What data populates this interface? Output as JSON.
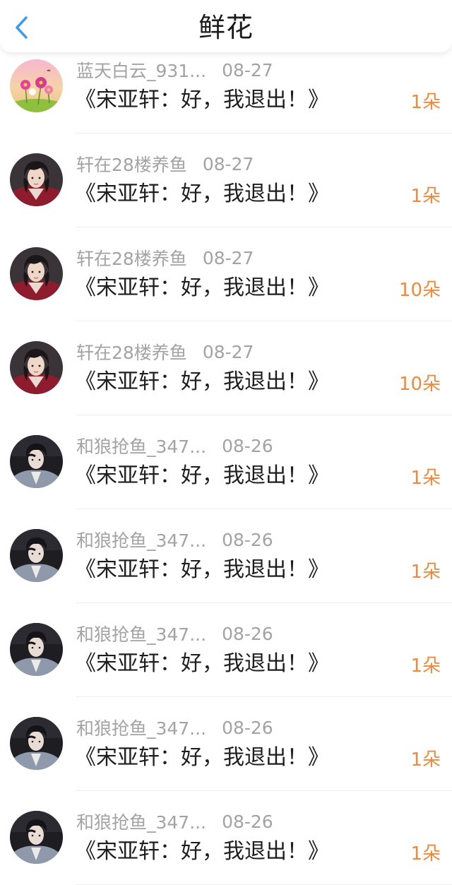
{
  "header": {
    "title": "鲜花",
    "back_icon": "chevron-left-icon",
    "accent_color": "#3a9bf0"
  },
  "count_color": "#ef8a3c",
  "entries": [
    {
      "user": "蓝天白云_931...",
      "date": "08-27",
      "book": "《宋亚轩：好，我退出！》",
      "count": "1朵",
      "avatar": "flowers"
    },
    {
      "user": "轩在28楼养鱼",
      "date": "08-27",
      "book": "《宋亚轩：好，我退出！》",
      "count": "1朵",
      "avatar": "red-robe"
    },
    {
      "user": "轩在28楼养鱼",
      "date": "08-27",
      "book": "《宋亚轩：好，我退出！》",
      "count": "10朵",
      "avatar": "red-robe"
    },
    {
      "user": "轩在28楼养鱼",
      "date": "08-27",
      "book": "《宋亚轩：好，我退出！》",
      "count": "10朵",
      "avatar": "red-robe"
    },
    {
      "user": "和狼抢鱼_347...",
      "date": "08-26",
      "book": "《宋亚轩：好，我退出！》",
      "count": "1朵",
      "avatar": "denim"
    },
    {
      "user": "和狼抢鱼_347...",
      "date": "08-26",
      "book": "《宋亚轩：好，我退出！》",
      "count": "1朵",
      "avatar": "denim"
    },
    {
      "user": "和狼抢鱼_347...",
      "date": "08-26",
      "book": "《宋亚轩：好，我退出！》",
      "count": "1朵",
      "avatar": "denim"
    },
    {
      "user": "和狼抢鱼_347...",
      "date": "08-26",
      "book": "《宋亚轩：好，我退出！》",
      "count": "1朵",
      "avatar": "denim"
    },
    {
      "user": "和狼抢鱼_347...",
      "date": "08-26",
      "book": "《宋亚轩：好，我退出！》",
      "count": "1朵",
      "avatar": "denim"
    }
  ]
}
